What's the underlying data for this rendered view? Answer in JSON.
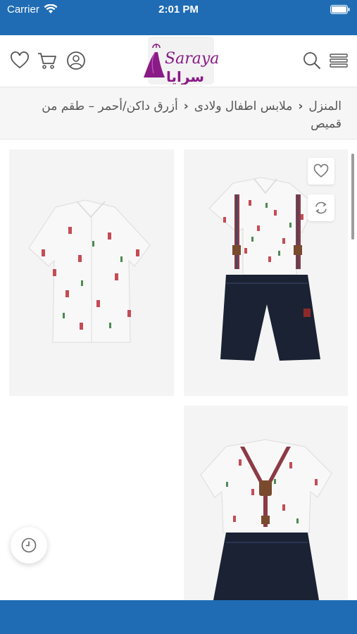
{
  "status_bar": {
    "carrier": "Carrier",
    "time": "2:01 PM"
  },
  "header": {
    "logo": {
      "latin": "Saraya",
      "arabic": "سرايا"
    },
    "icons_left": [
      "heart-icon",
      "cart-icon",
      "user-icon"
    ],
    "icons_right": [
      "search-icon",
      "menu-icon"
    ]
  },
  "breadcrumb": {
    "home": "المنزل",
    "category": "ملابس اطفال ولادى",
    "current": "أزرق داكن/أحمر – طقم من قميص"
  },
  "product_images": [
    {
      "name": "outfit-shirt-suspenders-shorts-main",
      "actions": [
        "heart-icon",
        "compare-icon"
      ]
    },
    {
      "name": "shirt-only"
    },
    {
      "name": "outfit-suspenders-back"
    }
  ],
  "floating": {
    "history_icon": "clock-icon"
  },
  "colors": {
    "brand_blue": "#1f6cb4",
    "logo_purple": "#8a1a86"
  }
}
